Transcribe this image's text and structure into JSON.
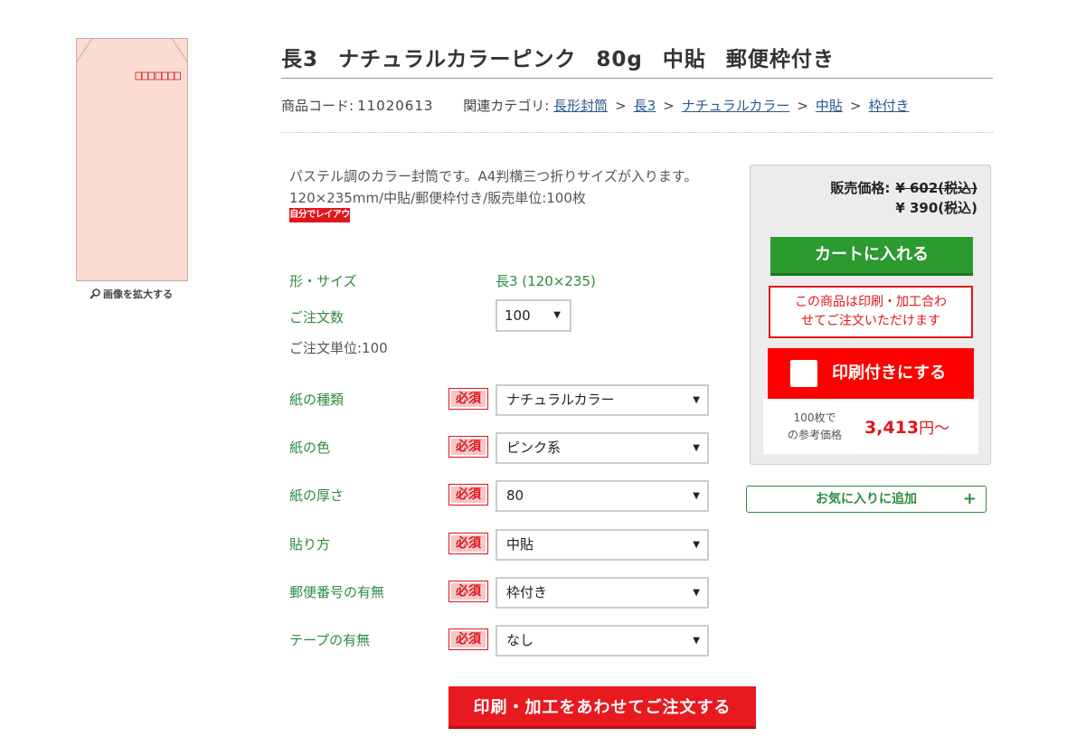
{
  "product": {
    "title_parts": [
      "長3",
      "ナチュラルカラーピンク",
      "80g",
      "中貼",
      "郵便枠付き"
    ],
    "zoom_label": "画像を拡大する",
    "code_label": "商品コード:",
    "code_value": "11020613",
    "category_label": "関連カテゴリ:",
    "categories": [
      "長形封筒",
      "長3",
      "ナチュラルカラー",
      "中貼",
      "枠付き"
    ],
    "category_separator": ">",
    "description_line1": "パステル調のカラー封筒です。A4判横三つ折りサイズが入ります。",
    "description_line2": "120×235mm/中貼/郵便枠付き/販売単位:100枚",
    "layout_badge": "自分でレイアウト",
    "envelope_color": "#fbdcd3",
    "postal_box_color": "#e0161b"
  },
  "specs": {
    "size_label": "形・サイズ",
    "size_value": "長3 (120×235)",
    "qty_label": "ご注文数",
    "qty_value": "100",
    "unit_text": "ご注文単位:100"
  },
  "options": [
    {
      "label": "紙の種類",
      "required": "必須",
      "value": "ナチュラルカラー"
    },
    {
      "label": "紙の色",
      "required": "必須",
      "value": "ピンク系"
    },
    {
      "label": "紙の厚さ",
      "required": "必須",
      "value": "80"
    },
    {
      "label": "貼り方",
      "required": "必須",
      "value": "中貼"
    },
    {
      "label": "郵便番号の有無",
      "required": "必須",
      "value": "枠付き"
    },
    {
      "label": "テープの有無",
      "required": "必須",
      "value": "なし"
    }
  ],
  "order_button": "印刷・加工をあわせてご注文する",
  "price_panel": {
    "price_label": "販売価格:",
    "original_price": "¥ 602(税込)",
    "sale_price": "¥ 390(税込)",
    "cart_button": "カートに入れる",
    "notice": "この商品は印刷・加工合わせてご注文いただけます",
    "print_toggle_label": "印刷付きにする",
    "ref_label": "100枚での参考価格",
    "ref_price": "3,413",
    "ref_price_suffix": "円〜"
  },
  "favorite_button": "お気に入りに追加",
  "favorite_plus": "+",
  "colors": {
    "accent_red": "#e0161b",
    "accent_green": "#2e8b3f",
    "cart_green": "#2b9a2f",
    "link_blue": "#2a5a8c"
  }
}
